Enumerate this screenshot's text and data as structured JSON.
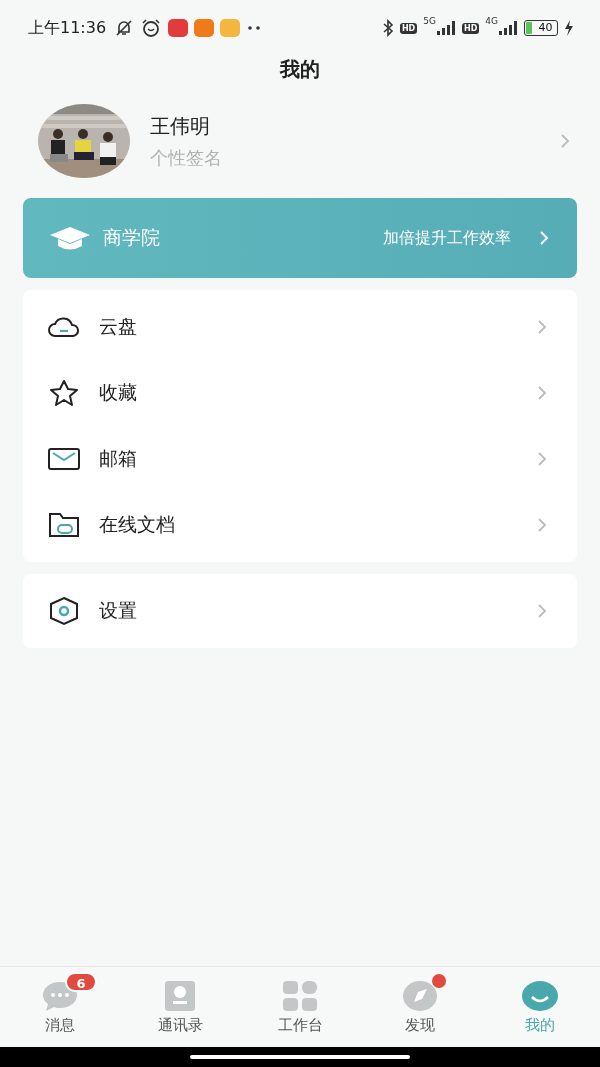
{
  "status_bar": {
    "time": "上午11:36",
    "hd_1": "HD",
    "network_1": "5G",
    "hd_2": "HD",
    "network_2": "4G",
    "battery": "40"
  },
  "title": "我的",
  "profile": {
    "name": "王伟明",
    "signature": "个性签名"
  },
  "banner": {
    "title": "商学院",
    "subtitle": "加倍提升工作效率"
  },
  "menu_groups": [
    {
      "items": [
        {
          "kind": "cloud",
          "label": "云盘"
        },
        {
          "kind": "star",
          "label": "收藏"
        },
        {
          "kind": "mail",
          "label": "邮箱"
        },
        {
          "kind": "folder",
          "label": "在线文档"
        }
      ]
    },
    {
      "items": [
        {
          "kind": "settings",
          "label": "设置"
        }
      ]
    }
  ],
  "tabs": [
    {
      "kind": "chat",
      "label": "消息",
      "selected": false,
      "badge": "6",
      "dot": false
    },
    {
      "kind": "contacts",
      "label": "通讯录",
      "selected": false,
      "dot": false
    },
    {
      "kind": "apps",
      "label": "工作台",
      "selected": false,
      "dot": false
    },
    {
      "kind": "compass",
      "label": "发现",
      "selected": false,
      "dot": true
    },
    {
      "kind": "me",
      "label": "我的",
      "selected": true,
      "dot": false
    }
  ]
}
